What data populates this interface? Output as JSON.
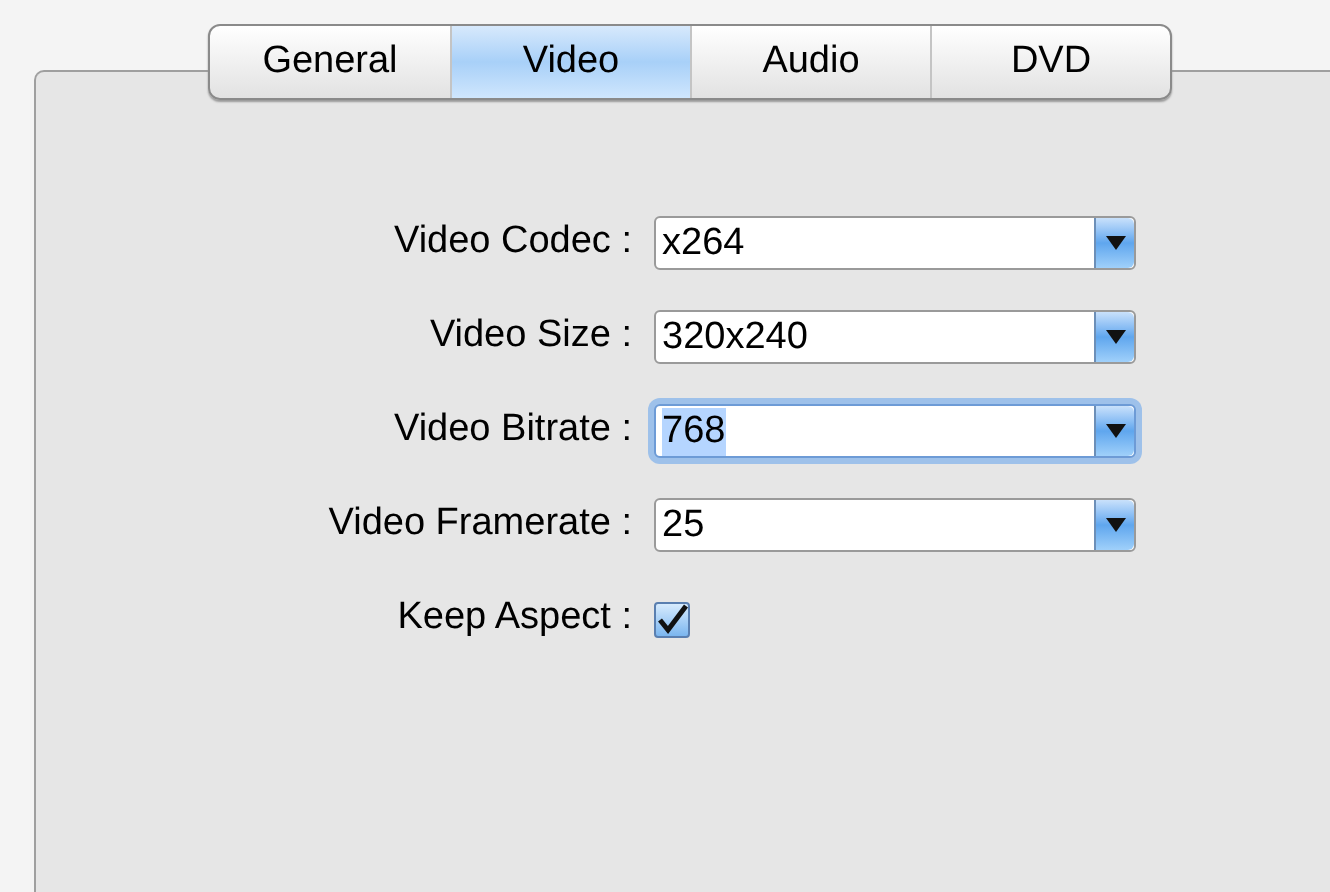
{
  "tabs": [
    {
      "label": "General",
      "selected": false
    },
    {
      "label": "Video",
      "selected": true
    },
    {
      "label": "Audio",
      "selected": false
    },
    {
      "label": "DVD",
      "selected": false
    }
  ],
  "fields": [
    {
      "kind": "combo",
      "label": "Video Codec :",
      "value": "x264",
      "focused": false
    },
    {
      "kind": "combo",
      "label": "Video Size :",
      "value": "320x240",
      "focused": false
    },
    {
      "kind": "combo",
      "label": "Video Bitrate :",
      "value": "768",
      "focused": true
    },
    {
      "kind": "combo",
      "label": "Video Framerate :",
      "value": "25",
      "focused": false
    },
    {
      "kind": "checkbox",
      "label": "Keep Aspect :",
      "checked": true
    }
  ]
}
